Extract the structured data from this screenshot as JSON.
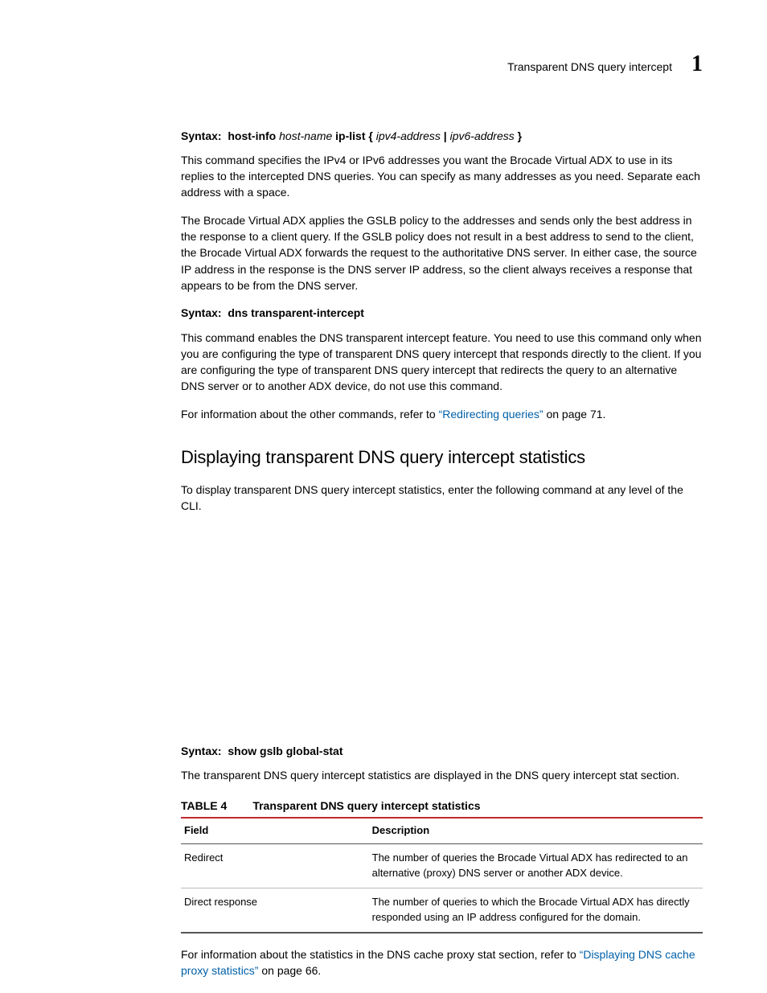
{
  "header": {
    "section_title": "Transparent DNS query intercept",
    "chapter_number": "1"
  },
  "syntax1": {
    "prefix": "Syntax:",
    "cmd_a": "host-info",
    "arg_a": "host-name",
    "cmd_b": "ip-list {",
    "arg_b": "ipv4-address",
    "pipe": " | ",
    "arg_c": "ipv6-address",
    "close": " }"
  },
  "p1": "This command specifies the IPv4 or IPv6 addresses you want the Brocade Virtual ADX to use in its replies to the intercepted DNS queries. You can specify as many addresses as you need. Separate each address with a space.",
  "p2": "The Brocade Virtual ADX applies the GSLB policy to the addresses and sends only the best address in the response to a client query. If the GSLB policy does not result in a best address to send to the client, the Brocade Virtual ADX forwards the request to the authoritative DNS server. In either case, the source IP address in the response is the DNS server IP address, so the client always receives a response that appears to be from the DNS server.",
  "syntax2": {
    "prefix": "Syntax:",
    "cmd": "dns transparent-intercept"
  },
  "p3": "This command enables the DNS transparent intercept feature. You need to use this command only when you are configuring the type of transparent DNS query intercept that responds directly to the client. If you are configuring the type of transparent DNS query intercept that redirects the query to an alternative DNS server or to another ADX device, do not use this command.",
  "p4_pre": "For information about the other commands, refer to ",
  "p4_link": "“Redirecting queries”",
  "p4_post": " on page 71.",
  "h2": "Displaying transparent DNS query intercept statistics",
  "p5": "To display transparent DNS query intercept statistics, enter the following command at any level of the CLI.",
  "syntax3": {
    "prefix": "Syntax:",
    "cmd": "show gslb global-stat"
  },
  "p6": "The transparent DNS query intercept statistics are displayed in the DNS query intercept stat section.",
  "table": {
    "number": "TABLE 4",
    "title": "Transparent DNS query intercept statistics",
    "head_field": "Field",
    "head_desc": "Description",
    "rows": [
      {
        "field": "Redirect",
        "desc": "The number of queries the Brocade Virtual ADX has redirected to an alternative (proxy) DNS server or another ADX device."
      },
      {
        "field": "Direct response",
        "desc": "The number of queries to which the Brocade Virtual ADX has directly responded using an IP address configured for the domain."
      }
    ]
  },
  "p7_pre": "For information about the statistics in the DNS cache proxy stat section, refer to ",
  "p7_link": "“Displaying DNS cache proxy statistics”",
  "p7_post": " on page 66."
}
